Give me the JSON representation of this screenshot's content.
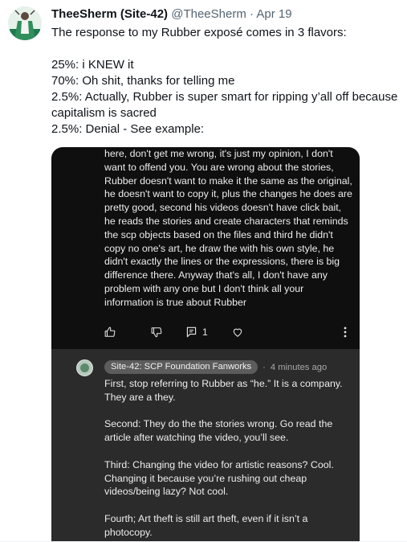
{
  "tweet": {
    "author_name": "TheeSherm (Site-42)",
    "handle": "@TheeSherm",
    "separator": "·",
    "date": "Apr 19",
    "lines": [
      "The response to my Rubber exposé comes in 3 flavors:",
      "",
      "25%: i KNEW it",
      "70%: Oh shit, thanks for telling me",
      "2.5%: Actually, Rubber is super smart for ripping y’all off because capitalism is sacred",
      "2.5%: Denial - See example:"
    ]
  },
  "media": {
    "comment_text": "here, don't get me wrong, it's just my opinion, I don't want to offend you. You are wrong about the stories, Rubber doesn't want to make it the same as the original, he doesn't want to copy it, plus the changes he does are pretty good, second his videos doesn't have click bait, he reads the stories and create characters that reminds the scp objects based on the files and third he didn't copy no one's art, he draw the with his own style, he didn't exactly the lines or the expressions, there is big difference there. Anyway that's all, I don't have any problem with any one but I don't think all your information is true about Rubber",
    "reply_count": "1",
    "reply": {
      "channel": "Site-42: SCP Foundation Fanworks",
      "separator": "·",
      "time": "4 minutes ago",
      "paragraphs": [
        "First, stop referring to Rubber as “he.” It is a company. They are a they.",
        "Second: They do the the stories wrong. Go read the article after watching the video, you’ll see.",
        "Third: Changing the video for artistic reasons? Cool. Changing it because you’re rushing out cheap videos/being lazy? Not cool.",
        "Fourth; Art theft is still art theft, even if it isn’t a photocopy."
      ]
    }
  },
  "colors": {
    "text_primary": "#0f1419",
    "text_secondary": "#536471",
    "media_bg": "#0f0f0f",
    "reply_bg": "#2b2b2b"
  }
}
